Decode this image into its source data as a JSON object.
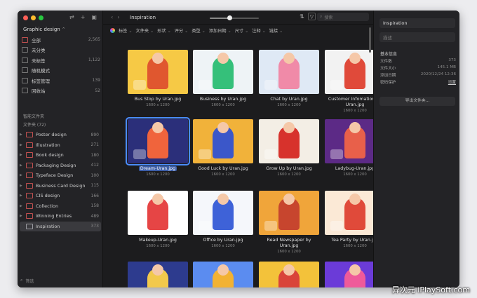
{
  "sidebar": {
    "library": "Graphic design",
    "items": [
      {
        "label": "全部",
        "count": "2,565",
        "icon": "all-icon",
        "color": "#c05050"
      },
      {
        "label": "未分类",
        "count": "",
        "icon": "unfiled-icon",
        "color": "#777"
      },
      {
        "label": "未标签",
        "count": "1,122",
        "icon": "untagged-icon",
        "color": "#777"
      },
      {
        "label": "随机模式",
        "count": "",
        "icon": "random-icon",
        "color": "#777"
      },
      {
        "label": "标签管理",
        "count": "139",
        "icon": "tag-icon",
        "color": "#777"
      },
      {
        "label": "回收站",
        "count": "52",
        "icon": "trash-icon",
        "color": "#777"
      }
    ],
    "smart_folders": "智能文件夹",
    "folders_header": "文件夹 (72)",
    "folders": [
      {
        "label": "Poster design",
        "count": "890"
      },
      {
        "label": "Illustration",
        "count": "271"
      },
      {
        "label": "Book design",
        "count": "180"
      },
      {
        "label": "Packaging Design",
        "count": "412"
      },
      {
        "label": "Typeface Design",
        "count": "100"
      },
      {
        "label": "Business Card Design",
        "count": "115"
      },
      {
        "label": "CIS design",
        "count": "166"
      },
      {
        "label": "Collection",
        "count": "158"
      },
      {
        "label": "Winning Entries",
        "count": "489"
      },
      {
        "label": "Inspiration",
        "count": "373"
      }
    ],
    "filter_placeholder": "筛选"
  },
  "toolbar": {
    "title": "Inspiration",
    "search_placeholder": "搜索",
    "thumb_size": 0.4,
    "filters": [
      "标签",
      "文件夹",
      "形状",
      "评分",
      "类型",
      "添加日期",
      "尺寸",
      "注释",
      "链接"
    ]
  },
  "grid": {
    "cards": [
      {
        "name": "Bus Stop by Uran.jpg",
        "dim": "1600 x 1200",
        "bg": "#f6c945",
        "fg": "#e0572f"
      },
      {
        "name": "Business by Uran.jpg",
        "dim": "1600 x 1200",
        "bg": "#eef3f6",
        "fg": "#35c07a"
      },
      {
        "name": "Chat by Uran.jpg",
        "dim": "1600 x 1200",
        "bg": "#dfe9f5",
        "fg": "#f08aa8"
      },
      {
        "name": "Customer Infomation by Uran.jpg",
        "dim": "1600 x 1200",
        "bg": "#f2f2f2",
        "fg": "#e04a3a"
      },
      {
        "name": "Dream-Uran.jpg",
        "dim": "1600 x 1200",
        "bg": "#2b2f7a",
        "fg": "#f0643c"
      },
      {
        "name": "Good Luck by Uran.jpg",
        "dim": "1600 x 1200",
        "bg": "#f1b23a",
        "fg": "#3b57c9"
      },
      {
        "name": "Grow Up by Uran.jpg",
        "dim": "1600 x 1200",
        "bg": "#f3eee5",
        "fg": "#d7322c"
      },
      {
        "name": "Ladybug-Uran.jpg",
        "dim": "1600 x 1200",
        "bg": "#5c2a86",
        "fg": "#e8604a"
      },
      {
        "name": "Makeup-Uran.jpg",
        "dim": "1600 x 1200",
        "bg": "#ffffff",
        "fg": "#e64545"
      },
      {
        "name": "Office by Uran.jpg",
        "dim": "1600 x 1200",
        "bg": "#f5f7fb",
        "fg": "#3e62d8"
      },
      {
        "name": "Read Newspaper by Uran.jpg",
        "dim": "1600 x 1200",
        "bg": "#f0a53a",
        "fg": "#c7452e"
      },
      {
        "name": "Tea Party by Uran.jpg",
        "dim": "1600 x 1200",
        "bg": "#fbe9d6",
        "fg": "#e04a3a"
      },
      {
        "name": "",
        "dim": "",
        "bg": "#2d3b8e",
        "fg": "#f2c94c"
      },
      {
        "name": "",
        "dim": "",
        "bg": "#5b8cf0",
        "fg": "#f2b233"
      },
      {
        "name": "",
        "dim": "",
        "bg": "#f3c23a",
        "fg": "#d9443a"
      },
      {
        "name": "",
        "dim": "",
        "bg": "#6b3bd8",
        "fg": "#ef5a9a"
      }
    ]
  },
  "inspector": {
    "name": "Inspiration",
    "desc_placeholder": "描述",
    "section": "基本信息",
    "rows": [
      {
        "k": "文件数",
        "v": "373"
      },
      {
        "k": "文件大小",
        "v": "145.1 MB"
      },
      {
        "k": "添加日期",
        "v": "2020/12/24 12:36"
      },
      {
        "k": "密码保护",
        "v": "设置"
      }
    ],
    "export": "导出文件夹..."
  },
  "watermark": "异次元 iPlaySoft.com"
}
